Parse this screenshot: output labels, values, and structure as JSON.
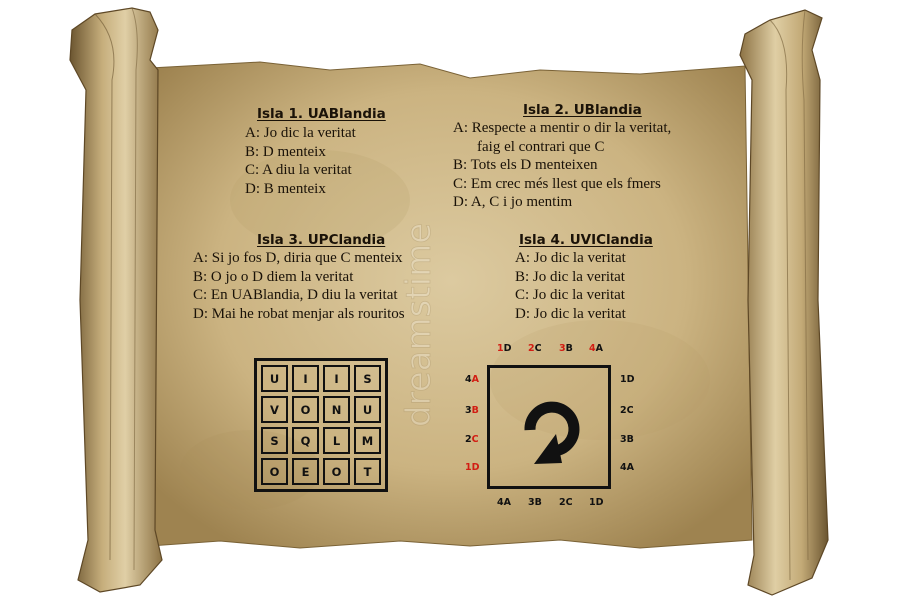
{
  "watermark": "dreamstime",
  "islands": [
    {
      "title": "Isla 1. UABlandia",
      "lines": [
        "A:  Jo dic la veritat",
        "B:  D menteix",
        "C:  A diu la veritat",
        "D:  B menteix"
      ]
    },
    {
      "title": "Isla 2. UBlandia",
      "lines": [
        "A:  Respecte a mentir o dir la veritat,",
        "faig el contrari que C",
        "B:  Tots els D menteixen",
        "C:  Em crec més llest que els fmers",
        "D:  A, C i jo mentim"
      ]
    },
    {
      "title": "Isla 3. UPClandia",
      "lines": [
        "A:  Si jo fos D, diria que C menteix",
        "B:  O jo o D diem la veritat",
        "C:  En UABlandia, D diu la veritat",
        "D:  Mai he robat menjar als rouritos"
      ]
    },
    {
      "title": "Isla 4. UVIClandia",
      "lines": [
        "A:  Jo dic la veritat",
        "B:  Jo dic la veritat",
        "C:  Jo dic la veritat",
        "D:  Jo dic la veritat"
      ]
    }
  ],
  "letter_grid": [
    [
      "U",
      "I",
      "I",
      "S"
    ],
    [
      "V",
      "O",
      "N",
      "U"
    ],
    [
      "S",
      "Q",
      "L",
      "M"
    ],
    [
      "O",
      "E",
      "O",
      "T"
    ]
  ],
  "door_labels": {
    "top": [
      {
        "num": "1",
        "let": "D"
      },
      {
        "num": "2",
        "let": "C"
      },
      {
        "num": "3",
        "let": "B"
      },
      {
        "num": "4",
        "let": "A"
      }
    ],
    "left": [
      {
        "num": "4",
        "let": "A"
      },
      {
        "num": "3",
        "let": "B"
      },
      {
        "num": "2",
        "let": "C"
      },
      {
        "num": "1",
        "let": "D"
      }
    ],
    "right": [
      "1D",
      "2C",
      "3B",
      "4A"
    ],
    "bottom": [
      "4A",
      "3B",
      "2C",
      "1D"
    ]
  },
  "colors": {
    "parchment": "#cbb483",
    "parchment_dark": "#8a6f3c",
    "ink": "#1a1208",
    "accent_red": "#d21c12"
  },
  "icons": {
    "door_icon": "rotate-arrow-icon"
  }
}
